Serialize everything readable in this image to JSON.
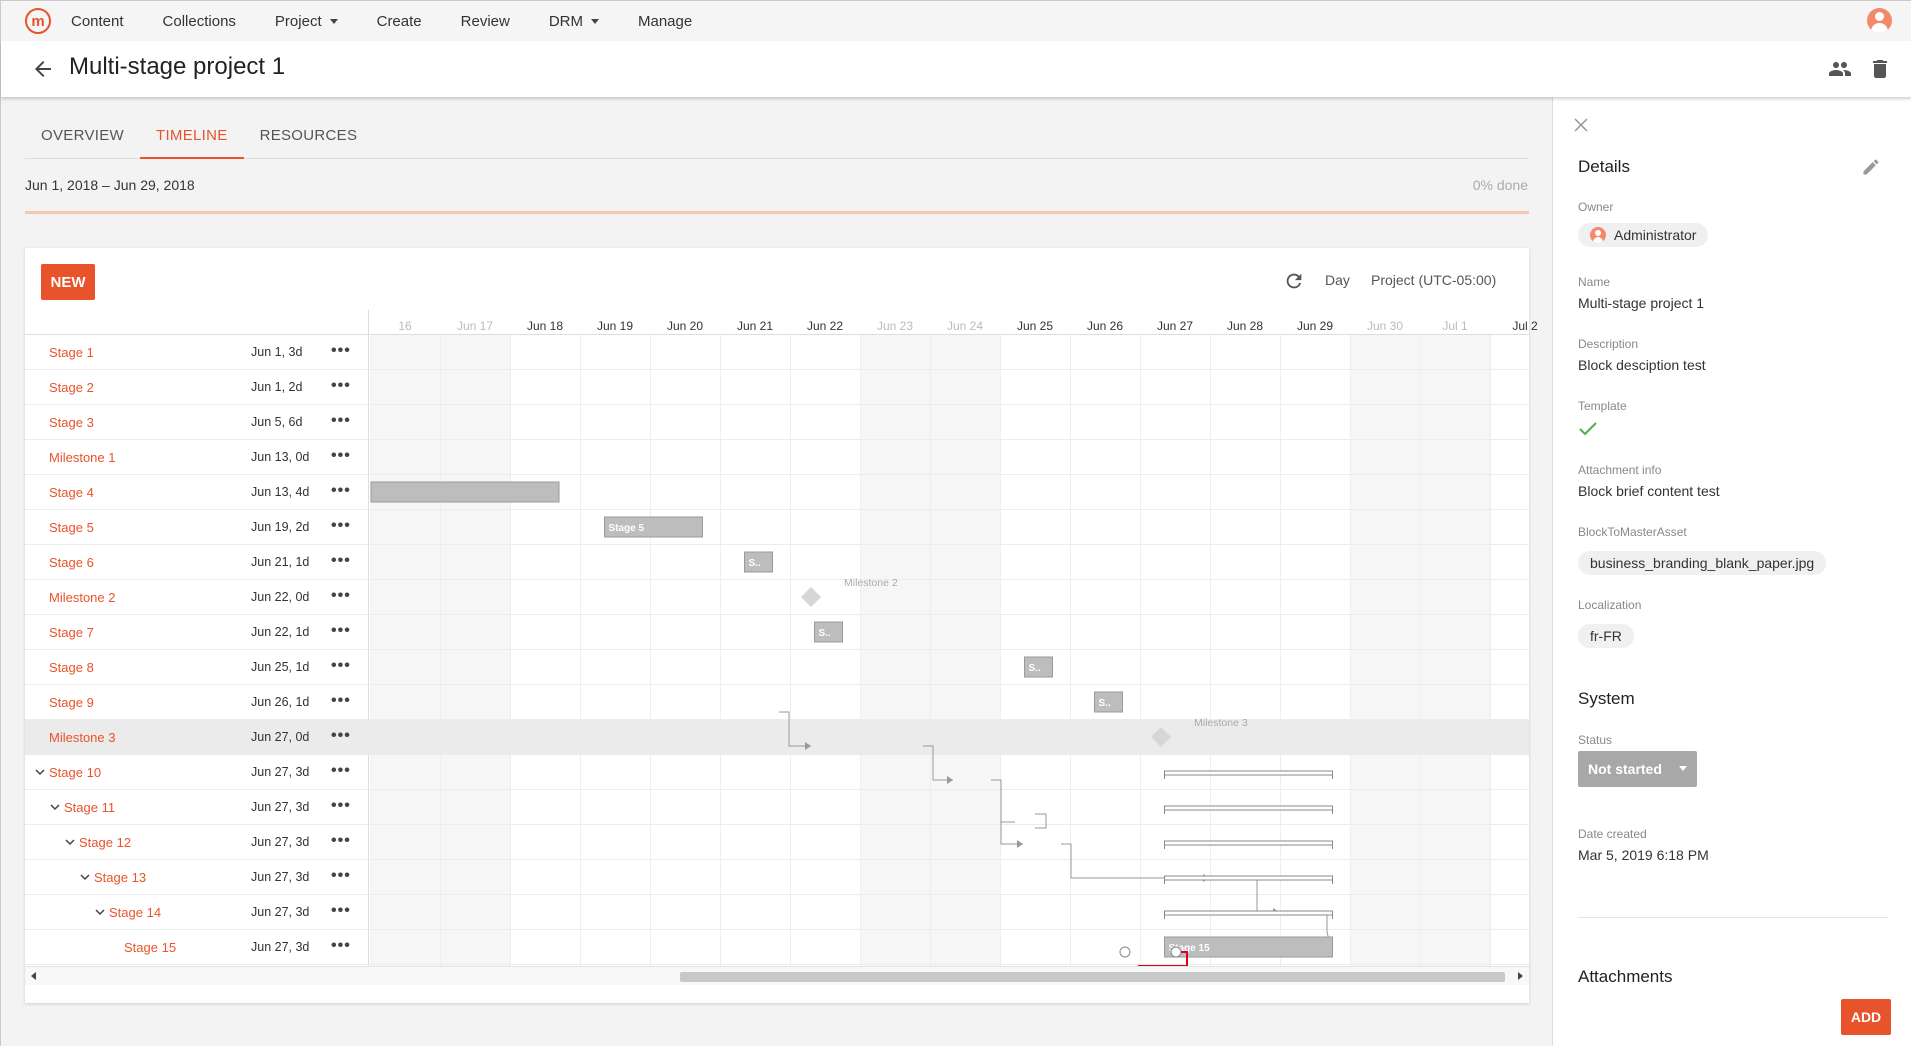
{
  "nav": {
    "logo": "m",
    "items": [
      {
        "label": "Content",
        "dropdown": false
      },
      {
        "label": "Collections",
        "dropdown": false
      },
      {
        "label": "Project",
        "dropdown": true
      },
      {
        "label": "Create",
        "dropdown": false
      },
      {
        "label": "Review",
        "dropdown": false
      },
      {
        "label": "DRM",
        "dropdown": true
      },
      {
        "label": "Manage",
        "dropdown": false
      }
    ]
  },
  "header": {
    "title": "Multi-stage project 1"
  },
  "tabs": [
    {
      "label": "OVERVIEW",
      "active": false
    },
    {
      "label": "TIMELINE",
      "active": true
    },
    {
      "label": "RESOURCES",
      "active": false
    }
  ],
  "timeline": {
    "date_range": "Jun 1, 2018 – Jun 29, 2018",
    "done_label": "0%  done",
    "progress": 0,
    "new_label": "NEW",
    "scale_label": "Day",
    "timezone_label": "Project (UTC-05:00)",
    "days": [
      {
        "label": "16",
        "weekend": true
      },
      {
        "label": "Jun 17",
        "weekend": true
      },
      {
        "label": "Jun 18",
        "weekend": false
      },
      {
        "label": "Jun 19",
        "weekend": false
      },
      {
        "label": "Jun 20",
        "weekend": false
      },
      {
        "label": "Jun 21",
        "weekend": false
      },
      {
        "label": "Jun 22",
        "weekend": false
      },
      {
        "label": "Jun 23",
        "weekend": true
      },
      {
        "label": "Jun 24",
        "weekend": true
      },
      {
        "label": "Jun 25",
        "weekend": false
      },
      {
        "label": "Jun 26",
        "weekend": false
      },
      {
        "label": "Jun 27",
        "weekend": false
      },
      {
        "label": "Jun 28",
        "weekend": false
      },
      {
        "label": "Jun 29",
        "weekend": false
      },
      {
        "label": "Jun 30",
        "weekend": true
      },
      {
        "label": "Jul 1",
        "weekend": true
      },
      {
        "label": "Jul 2",
        "weekend": false
      }
    ],
    "rows": [
      {
        "name": "Stage 1",
        "date": "Jun 1, 3d",
        "level": 0,
        "collapsible": false,
        "selected": false
      },
      {
        "name": "Stage 2",
        "date": "Jun 1, 2d",
        "level": 0,
        "collapsible": false,
        "selected": false
      },
      {
        "name": "Stage 3",
        "date": "Jun 5, 6d",
        "level": 0,
        "collapsible": false,
        "selected": false
      },
      {
        "name": "Milestone 1",
        "date": "Jun 13, 0d",
        "level": 0,
        "collapsible": false,
        "selected": false
      },
      {
        "name": "Stage 4",
        "date": "Jun 13, 4d",
        "level": 0,
        "collapsible": false,
        "selected": false
      },
      {
        "name": "Stage 5",
        "date": "Jun 19, 2d",
        "level": 0,
        "collapsible": false,
        "selected": false
      },
      {
        "name": "Stage 6",
        "date": "Jun 21, 1d",
        "level": 0,
        "collapsible": false,
        "selected": false
      },
      {
        "name": "Milestone 2",
        "date": "Jun 22, 0d",
        "level": 0,
        "collapsible": false,
        "selected": false
      },
      {
        "name": "Stage 7",
        "date": "Jun 22, 1d",
        "level": 0,
        "collapsible": false,
        "selected": false
      },
      {
        "name": "Stage 8",
        "date": "Jun 25, 1d",
        "level": 0,
        "collapsible": false,
        "selected": false
      },
      {
        "name": "Stage 9",
        "date": "Jun 26, 1d",
        "level": 0,
        "collapsible": false,
        "selected": false
      },
      {
        "name": "Milestone 3",
        "date": "Jun 27, 0d",
        "level": 0,
        "collapsible": false,
        "selected": true
      },
      {
        "name": "Stage 10",
        "date": "Jun 27, 3d",
        "level": 0,
        "collapsible": true,
        "selected": false
      },
      {
        "name": "Stage 11",
        "date": "Jun 27, 3d",
        "level": 1,
        "collapsible": true,
        "selected": false
      },
      {
        "name": "Stage 12",
        "date": "Jun 27, 3d",
        "level": 2,
        "collapsible": true,
        "selected": false
      },
      {
        "name": "Stage 13",
        "date": "Jun 27, 3d",
        "level": 3,
        "collapsible": true,
        "selected": false
      },
      {
        "name": "Stage 14",
        "date": "Jun 27, 3d",
        "level": 4,
        "collapsible": true,
        "selected": false
      },
      {
        "name": "Stage 15",
        "date": "Jun 27, 3d",
        "level": 5,
        "collapsible": false,
        "selected": false
      }
    ],
    "bars": [
      {
        "row": 4,
        "start": "Jun 16",
        "end": "Jun 18.7",
        "label": ""
      },
      {
        "row": 5,
        "start": "Jun 19.35",
        "end": "Jun 20.75",
        "label": "Stage 5"
      },
      {
        "row": 6,
        "start": "Jun 21.35",
        "end": "Jun 21.75",
        "label": "S.."
      },
      {
        "row": 8,
        "start": "Jun 22.35",
        "end": "Jun 22.75",
        "label": "S.."
      },
      {
        "row": 9,
        "start": "Jun 25.35",
        "end": "Jun 25.75",
        "label": "S.."
      },
      {
        "row": 10,
        "start": "Jun 26.35",
        "end": "Jun 26.75",
        "label": "S.."
      },
      {
        "row": 17,
        "start": "Jun 27.35",
        "end": "Jun 29.75",
        "label": "Stage 15"
      }
    ],
    "summaries": [
      {
        "row": 12,
        "start": "Jun 27.35",
        "end": "Jun 29.75"
      },
      {
        "row": 13,
        "start": "Jun 27.35",
        "end": "Jun 29.75"
      },
      {
        "row": 14,
        "start": "Jun 27.35",
        "end": "Jun 29.75"
      },
      {
        "row": 15,
        "start": "Jun 27.35",
        "end": "Jun 29.75"
      },
      {
        "row": 16,
        "start": "Jun 27.35",
        "end": "Jun 29.75"
      }
    ],
    "milestones": [
      {
        "row": 7,
        "date": "Jun 22.3",
        "label": "Milestone 2"
      },
      {
        "row": 11,
        "date": "Jun 27.3",
        "label": "Milestone 3"
      }
    ]
  },
  "details": {
    "title": "Details",
    "owner_label": "Owner",
    "owner": "Administrator",
    "name_label": "Name",
    "name": "Multi-stage project 1",
    "description_label": "Description",
    "description": "Block desciption test",
    "template_label": "Template",
    "template": true,
    "attachment_info_label": "Attachment info",
    "attachment_info": "Block brief content test",
    "block_to_master_label": "BlockToMasterAsset",
    "block_to_master": "business_branding_blank_paper.jpg",
    "localization_label": "Localization",
    "localization": "fr-FR",
    "system_title": "System",
    "status_label": "Status",
    "status": "Not started",
    "date_created_label": "Date created",
    "date_created": "Mar 5, 2019 6:18 PM",
    "attachments_title": "Attachments",
    "add_label": "ADD"
  },
  "colors": {
    "accent": "#e8532b",
    "bar": "#bdbdbd",
    "bar_border": "#9a9a9a",
    "link": "#999999",
    "critical_link": "#e0001b",
    "check": "#4caf50"
  }
}
